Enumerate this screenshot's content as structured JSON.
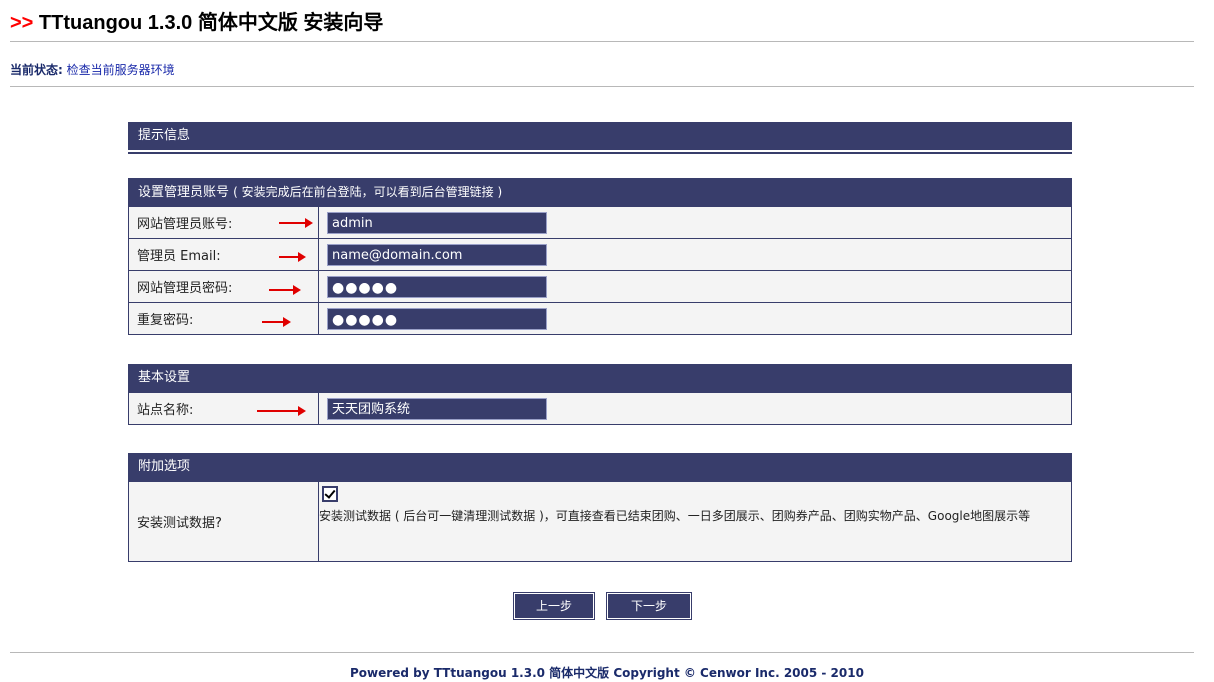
{
  "header": {
    "prefix": ">>",
    "title": "TTtuangou 1.3.0 简体中文版 安装向导"
  },
  "status": {
    "label": "当前状态:",
    "value": "检查当前服务器环境"
  },
  "hint": {
    "title": "提示信息"
  },
  "admin": {
    "title": "设置管理员账号",
    "note": "( 安装完成后在前台登陆，可以看到后台管理链接 )",
    "fields": [
      {
        "label": "网站管理员账号:",
        "value": "admin"
      },
      {
        "label": "管理员 Email:",
        "value": "name@domain.com"
      },
      {
        "label": "网站管理员密码:",
        "value": "●●●●●"
      },
      {
        "label": "重复密码:",
        "value": "●●●●●"
      }
    ]
  },
  "basic": {
    "title": "基本设置",
    "fields": [
      {
        "label": "站点名称:",
        "value": "天天团购系统"
      }
    ]
  },
  "extra": {
    "title": "附加选项",
    "option_label": "安装测试数据?",
    "option_checked": true,
    "option_desc": "安装测试数据 ( 后台可一键清理测试数据 )，可直接查看已结束团购、一日多团展示、团购券产品、团购实物产品、Google地图展示等"
  },
  "buttons": {
    "prev": "上一步",
    "next": "下一步"
  },
  "footer": {
    "text": "Powered by TTtuangou 1.3.0 简体中文版  Copyright © Cenwor Inc. 2005 - 2010"
  },
  "colors": {
    "header_bg": "#383d6b",
    "arrow": "#e00000",
    "title_prefix": "#ff0000"
  }
}
